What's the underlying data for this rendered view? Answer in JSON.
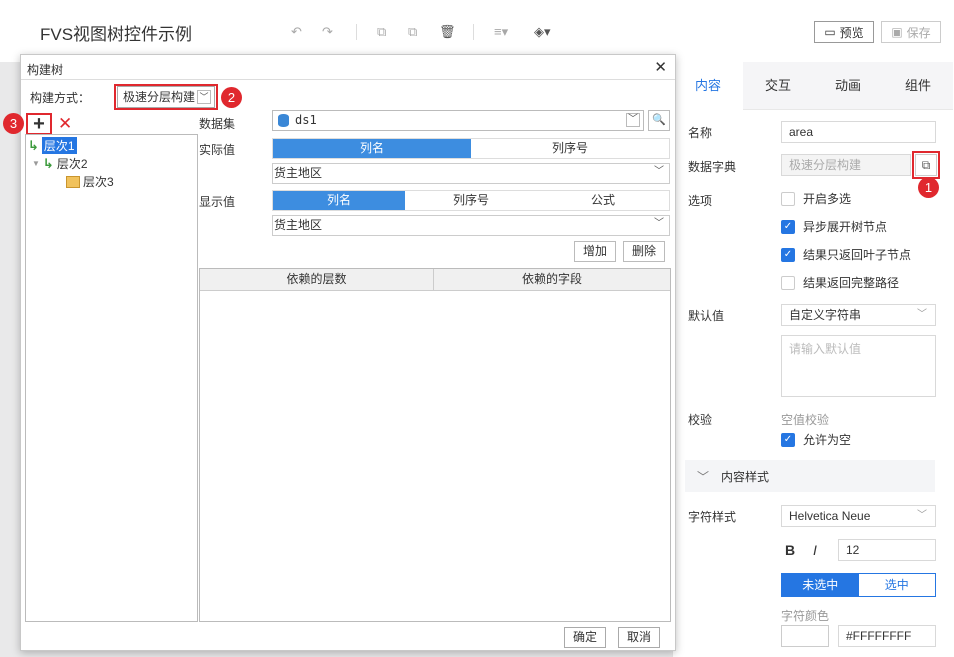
{
  "app": {
    "title": "FVS视图树控件示例"
  },
  "toolbar": {
    "preview_label": "预览",
    "save_label": "保存"
  },
  "dialog": {
    "title": "构建树",
    "mode_label": "构建方式：",
    "mode_value": "极速分层构建",
    "tree": [
      {
        "label": "层次1",
        "selected": true
      },
      {
        "label": "层次2",
        "selected": false
      },
      {
        "label": "层次3",
        "selected": false
      }
    ],
    "dataset_label": "数据集",
    "dataset_value": "ds1",
    "actual_label": "实际值",
    "actual_tabs": [
      "列名",
      "列序号"
    ],
    "actual_field": "货主地区",
    "display_label": "显示值",
    "display_tabs": [
      "列名",
      "列序号",
      "公式"
    ],
    "display_field": "货主地区",
    "add_label": "增加",
    "delete_label": "删除",
    "table_headers": [
      "依赖的层数",
      "依赖的字段"
    ],
    "ok_label": "确定",
    "cancel_label": "取消"
  },
  "panel": {
    "tabs": [
      "内容",
      "交互",
      "动画",
      "组件"
    ],
    "name_label": "名称",
    "name_value": "area",
    "dict_label": "数据字典",
    "dict_value": "极速分层构建",
    "options_label": "选项",
    "options": [
      {
        "label": "开启多选",
        "checked": false
      },
      {
        "label": "异步展开树节点",
        "checked": true
      },
      {
        "label": "结果只返回叶子节点",
        "checked": true
      },
      {
        "label": "结果返回完整路径",
        "checked": false
      }
    ],
    "default_label": "默认值",
    "default_type": "自定义字符串",
    "default_placeholder": "请输入默认值",
    "validate_label": "校验",
    "validate_sub": "空值校验",
    "allow_empty_label": "允许为空",
    "section_title": "内容样式",
    "font_label": "字符样式",
    "font_value": "Helvetica Neue",
    "bold_glyph": "B",
    "italic_glyph": "I",
    "font_size": "12",
    "toggle_unselected": "未选中",
    "toggle_selected": "选中",
    "color_label": "字符颜色",
    "color_value": "#FFFFFFFF"
  },
  "badges": [
    "1",
    "2",
    "3"
  ],
  "colors": {
    "accent": "#2576e2",
    "marker": "#e0282e"
  }
}
